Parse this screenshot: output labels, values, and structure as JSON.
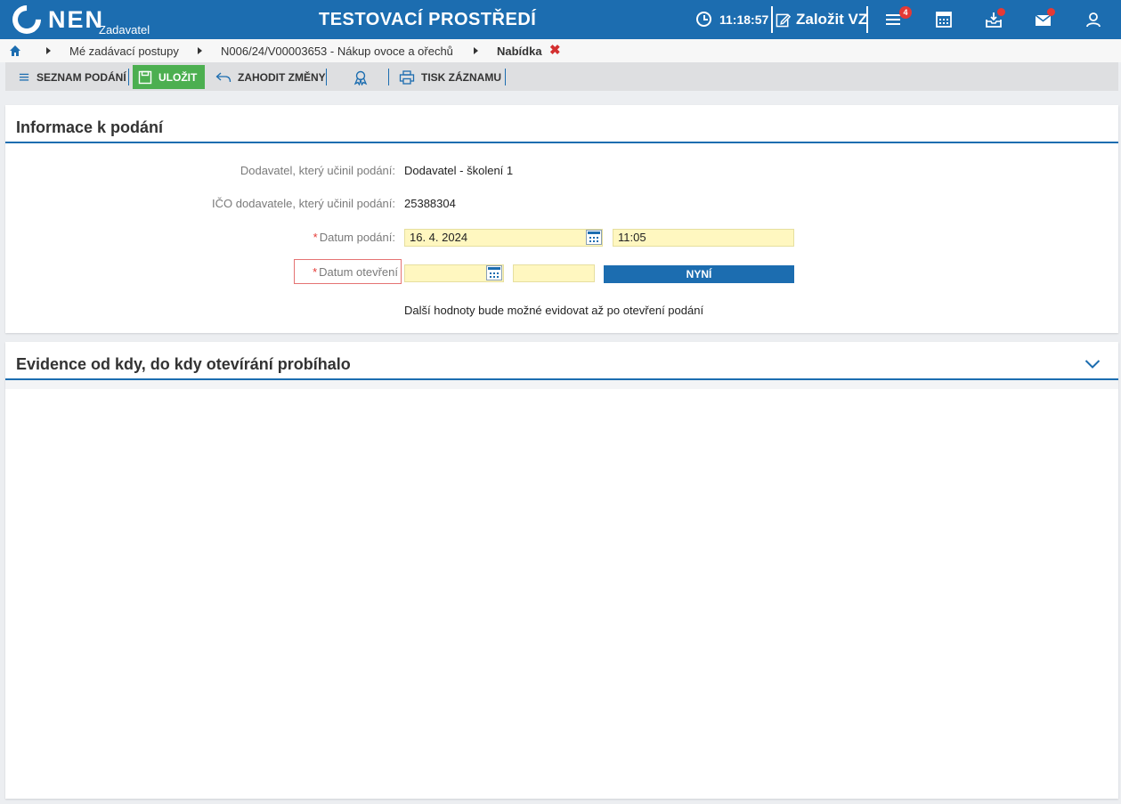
{
  "header": {
    "logo_text": "NEN",
    "logo_sub": "Zadavatel",
    "env_title": "TESTOVACÍ PROSTŘEDÍ",
    "clock_time": "11:18:57",
    "new_vz_label": "Založit VZ",
    "notifications_count": "4"
  },
  "breadcrumb": {
    "items": [
      "Mé zadávací postupy",
      "N006/24/V00003653 - Nákup ovoce a ořechů",
      "Nabídka"
    ],
    "close_glyph": "✖"
  },
  "toolbar": {
    "list_label": "SEZNAM PODÁNÍ",
    "save_label": "ULOŽIT",
    "discard_label": "ZAHODIT ZMĚNY",
    "print_label": "TISK ZÁZNAMU"
  },
  "info_panel": {
    "title": "Informace k podání",
    "supplier_label": "Dodavatel, který učinil podání:",
    "supplier_value": "Dodavatel - školení 1",
    "ico_label": "IČO dodavatele, který učinil podání:",
    "ico_value": "25388304",
    "submit_date_label": "Datum podání:",
    "submit_date_value": "16. 4. 2024",
    "submit_time_value": "11:05",
    "open_date_label": "Datum otevření",
    "open_date_value": "",
    "open_time_value": "",
    "now_button": "NYNÍ",
    "note": "Další hodnoty bude možné evidovat až po otevření podání",
    "required_mark": "*"
  },
  "evidence_panel": {
    "title": "Evidence od kdy, do kdy otevírání probíhalo",
    "expanded": false
  },
  "colors": {
    "brand": "#1c6db0",
    "save_green": "#4caf50",
    "badge_red": "#e53935",
    "input_yellow": "#fff7c0"
  }
}
